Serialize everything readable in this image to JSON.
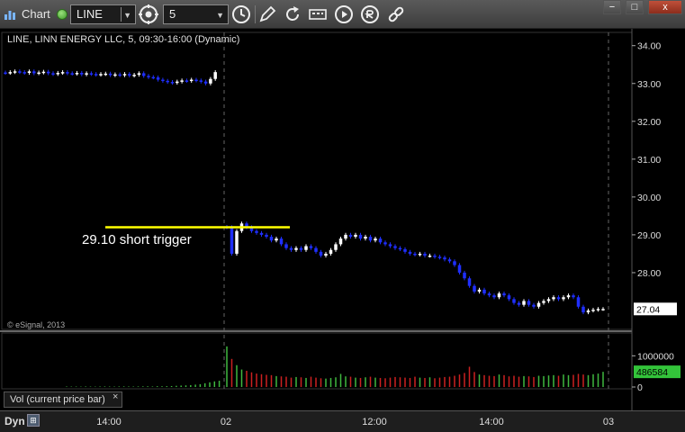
{
  "toolbar": {
    "app_title": "Chart",
    "symbol": "LINE",
    "interval": "5",
    "icons": [
      "clock-icon",
      "draw-pencil-icon",
      "refresh-icon",
      "keyboard-icon",
      "play-icon",
      "quote-icon",
      "link-icon"
    ]
  },
  "window_controls": {
    "close_label": "x"
  },
  "chart_data": [
    {
      "type": "candlestick",
      "title": "LINE, LINN ENERGY LLC, 5, 09:30-16:00 (Dynamic)",
      "copyright": "© eSignal, 2013",
      "y_ticks": [
        "34.00",
        "33.00",
        "32.00",
        "31.00",
        "30.00",
        "29.00",
        "28.00"
      ],
      "ylim": [
        26.5,
        34.35
      ],
      "last_price_label": "27.04",
      "last_price": 27.04,
      "x_tick_labels": [
        "14:00",
        "02",
        "12:00",
        "14:00",
        "03"
      ],
      "annotation": {
        "text": "29.10 short trigger",
        "price": 29.2
      },
      "colors": {
        "up": "#ffffff",
        "down": "#1f2fff",
        "annotation": "#ffff00",
        "grid": "#2a2a2a"
      },
      "day1_close_segment": [
        33.28,
        33.3,
        33.32,
        33.3,
        33.28,
        33.32,
        33.27,
        33.29,
        33.31,
        33.27,
        33.25,
        33.28,
        33.3,
        33.27,
        33.26,
        33.28,
        33.24,
        33.27,
        33.25,
        33.23,
        33.25,
        33.26,
        33.22,
        33.24,
        33.22,
        33.25,
        33.21,
        33.23,
        33.27,
        33.2,
        33.17,
        33.16,
        33.1,
        33.07,
        33.04,
        33.02,
        33.05,
        33.08,
        33.07,
        33.1,
        33.08,
        33.05,
        33.0,
        33.12,
        33.3
      ],
      "day2_closes": [
        29.2,
        28.5,
        29.1,
        29.3,
        29.2,
        29.1,
        29.05,
        29.0,
        28.95,
        28.85,
        28.9,
        28.75,
        28.65,
        28.6,
        28.65,
        28.6,
        28.7,
        28.65,
        28.55,
        28.45,
        28.5,
        28.6,
        28.75,
        28.9,
        29.0,
        28.95,
        29.0,
        28.9,
        28.95,
        28.85,
        28.9,
        28.8,
        28.75,
        28.7,
        28.65,
        28.62,
        28.55,
        28.5,
        28.48,
        28.5,
        28.45,
        28.45,
        28.42,
        28.4,
        28.35,
        28.3,
        28.2,
        28.0,
        27.85,
        27.65,
        27.5,
        27.55,
        27.45,
        27.4,
        27.35,
        27.45,
        27.4,
        27.3,
        27.2,
        27.15,
        27.25,
        27.15,
        27.1,
        27.2,
        27.25,
        27.3,
        27.35,
        27.3,
        27.35,
        27.4,
        27.35,
        27.1,
        26.95,
        27.0,
        27.02,
        27.04,
        27.04
      ]
    },
    {
      "type": "bar",
      "title": "Vol (current price bar)",
      "y_ticks": [
        "1000000",
        "0"
      ],
      "last_volume_label": "486584",
      "last_volume": 486584,
      "colors": {
        "up": "#3fb83f",
        "down": "#cc2020",
        "label_bg": "#33c43a"
      },
      "day1_volumes": [
        15000,
        12000,
        14000,
        11000,
        16000,
        13000,
        12000,
        15000,
        17000,
        14000,
        13000,
        16000,
        18000,
        15000,
        14000,
        17000,
        19000,
        21000,
        16000,
        24000,
        22000,
        26000,
        30000,
        38000,
        45000,
        52000,
        60000,
        75000,
        90000,
        120000,
        150000,
        180000,
        200000
      ],
      "day2_volumes": [
        1300000,
        900000,
        700000,
        560000,
        520000,
        470000,
        430000,
        410000,
        390000,
        380000,
        350000,
        340000,
        330000,
        300000,
        320000,
        310000,
        290000,
        330000,
        300000,
        280000,
        270000,
        290000,
        310000,
        420000,
        340000,
        330000,
        300000,
        290000,
        310000,
        330000,
        300000,
        290000,
        280000,
        300000,
        320000,
        310000,
        300000,
        290000,
        330000,
        300000,
        290000,
        310000,
        280000,
        300000,
        320000,
        330000,
        360000,
        400000,
        450000,
        650000,
        480000,
        400000,
        380000,
        360000,
        350000,
        400000,
        380000,
        340000,
        360000,
        330000,
        350000,
        340000,
        320000,
        360000,
        350000,
        370000,
        380000,
        360000,
        400000,
        380000,
        390000,
        420000,
        400000,
        380000,
        410000,
        430000,
        486584
      ]
    }
  ],
  "status": {
    "dyn_label": "Dyn"
  }
}
